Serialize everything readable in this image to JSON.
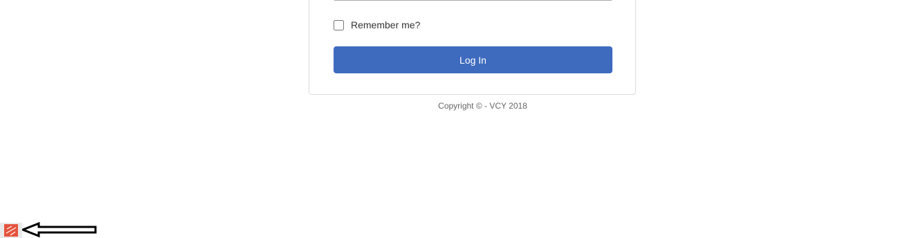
{
  "login": {
    "remember_label": "Remember me?",
    "login_button_label": "Log In"
  },
  "footer": {
    "copyright": "Copyright © - VCY 2018"
  },
  "icons": {
    "taskbar_app": "app-icon",
    "pointer_arrow": "left-arrow-icon"
  },
  "colors": {
    "primary_button": "#3f6bbf",
    "app_icon": "#e5533d"
  }
}
